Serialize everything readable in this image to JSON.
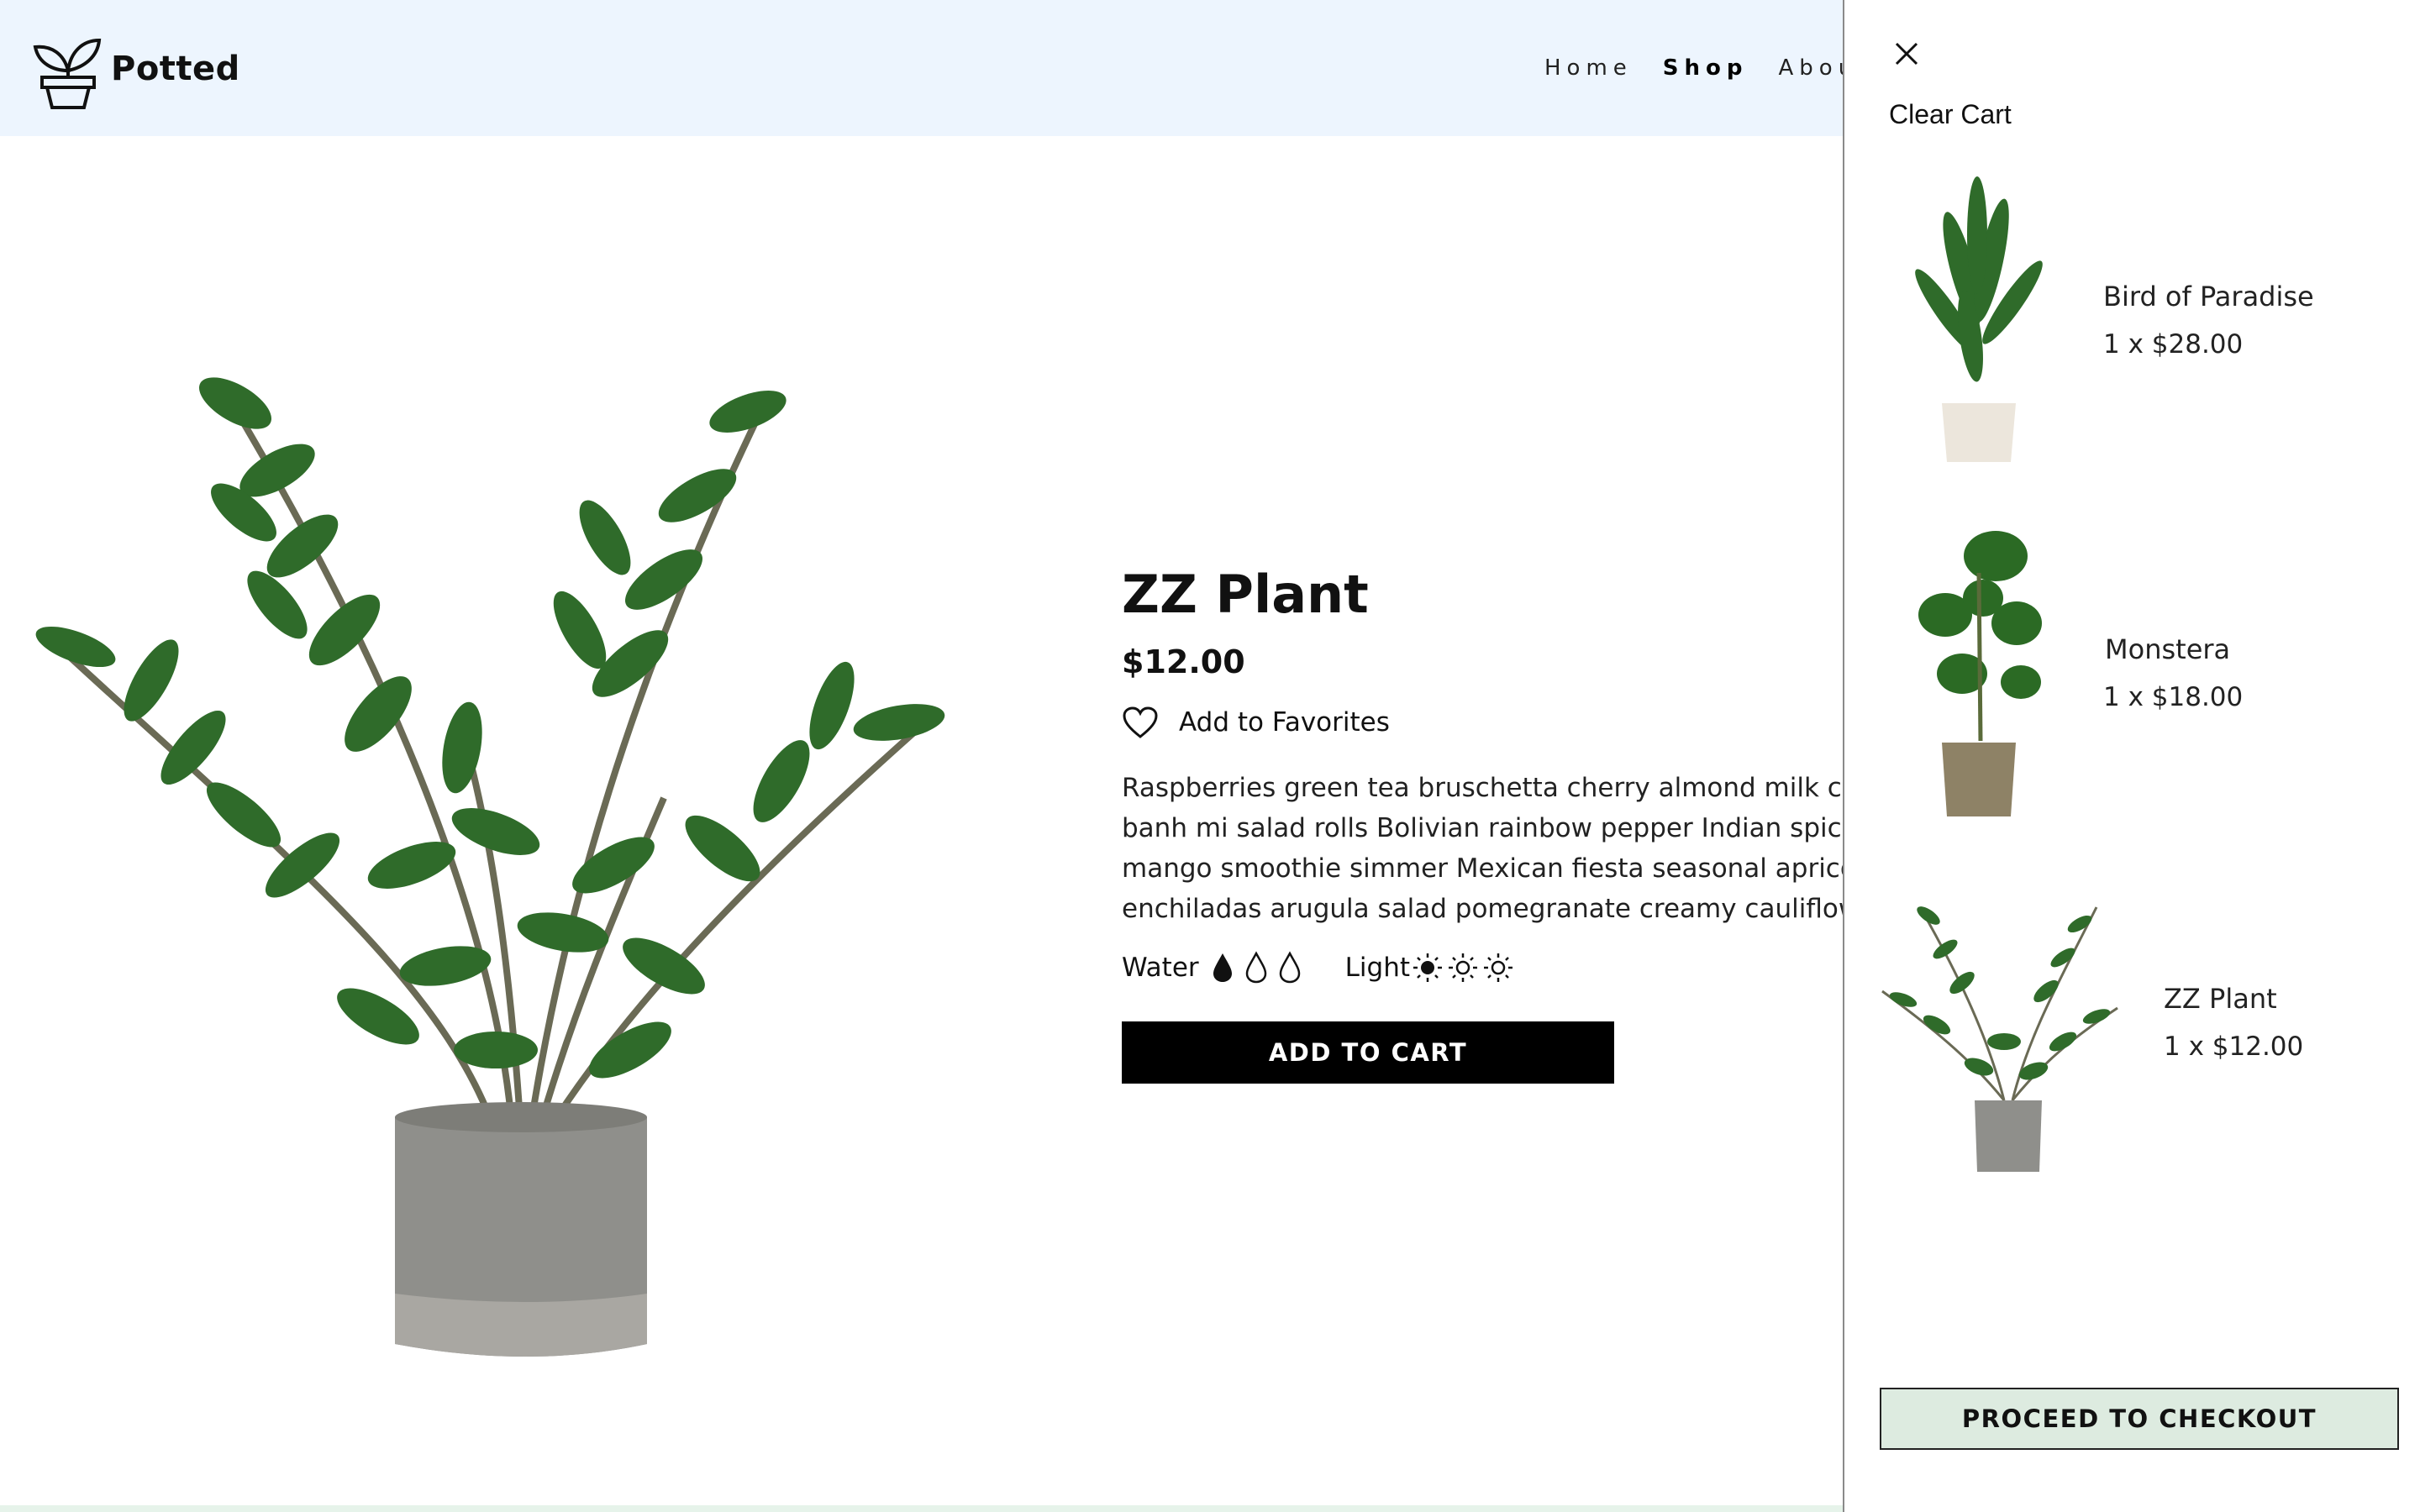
{
  "brand": {
    "name": "Potted"
  },
  "nav": {
    "items": [
      "Home",
      "Shop",
      "About"
    ],
    "active": "Shop"
  },
  "product": {
    "title": "ZZ Plant",
    "price": "$12.00",
    "favorite_label": "Add to Favorites",
    "description_lines": [
      "Raspberries green tea bruschetta cherry almond milk cha",
      "banh mi salad rolls Bolivian rainbow pepper Indian spiced",
      "mango smoothie simmer Mexican fiesta seasonal apricot",
      "enchiladas arugula salad pomegranate creamy cauliflowe"
    ],
    "water_label": "Water",
    "water_level": 1,
    "water_max": 3,
    "light_label": "Light",
    "light_level": 1,
    "light_max": 3,
    "add_to_cart_label": "ADD TO CART"
  },
  "cart": {
    "close_icon": "close-icon",
    "clear_label": "Clear Cart",
    "items": [
      {
        "name": "Bird of Paradise",
        "qty_price": "1 x $28.00"
      },
      {
        "name": "Monstera",
        "qty_price": "1 x $18.00"
      },
      {
        "name": "ZZ Plant",
        "qty_price": "1 x $12.00"
      }
    ],
    "checkout_label": "PROCEED TO CHECKOUT"
  },
  "colors": {
    "header_bg": "#edf5fe",
    "button_bg": "#000000",
    "checkout_bg": "#ddebe0",
    "leaf": "#2f6b2a",
    "pot": "#8f8f8b"
  }
}
